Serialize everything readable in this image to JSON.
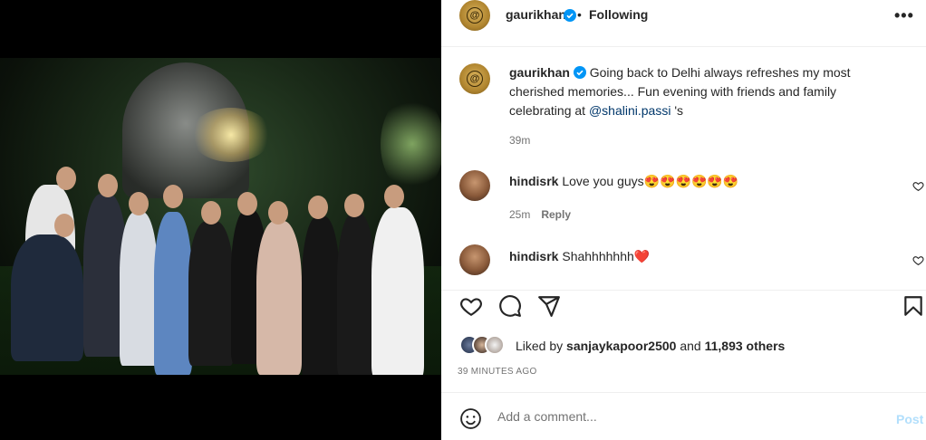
{
  "post": {
    "author": "gaurikhan",
    "dot": "•",
    "follow_status": "Following",
    "caption": {
      "username": "gaurikhan",
      "text_before": "Going back to Delhi always refreshes my most cherished memories... Fun evening with friends and family celebrating at ",
      "mention": "@shalini.passi",
      "text_after": " 's",
      "time": "39m"
    },
    "comments": [
      {
        "username": "hindisrk",
        "text": "Love you guys",
        "emoji": "😍😍😍😍😍😍",
        "time": "25m",
        "reply_label": "Reply"
      },
      {
        "username": "hindisrk",
        "text": "Shahhhhhhh",
        "emoji": "❤️"
      }
    ],
    "likes": {
      "prefix": "Liked by",
      "user": "sanjaykapoor2500",
      "and": "and",
      "count": "11,893 others"
    },
    "posted_ago": "39 MINUTES AGO",
    "comment_placeholder": "Add a comment...",
    "post_label": "Post"
  },
  "colors": {
    "verified": "#0095f6",
    "emoji_heart": "#e0245e",
    "mention": "#00376b",
    "post_disabled": "#b2dffc"
  },
  "icons": [
    "more-options-icon",
    "verified-badge-icon",
    "heart-icon",
    "comment-icon",
    "share-icon",
    "bookmark-icon",
    "emoji-icon"
  ]
}
